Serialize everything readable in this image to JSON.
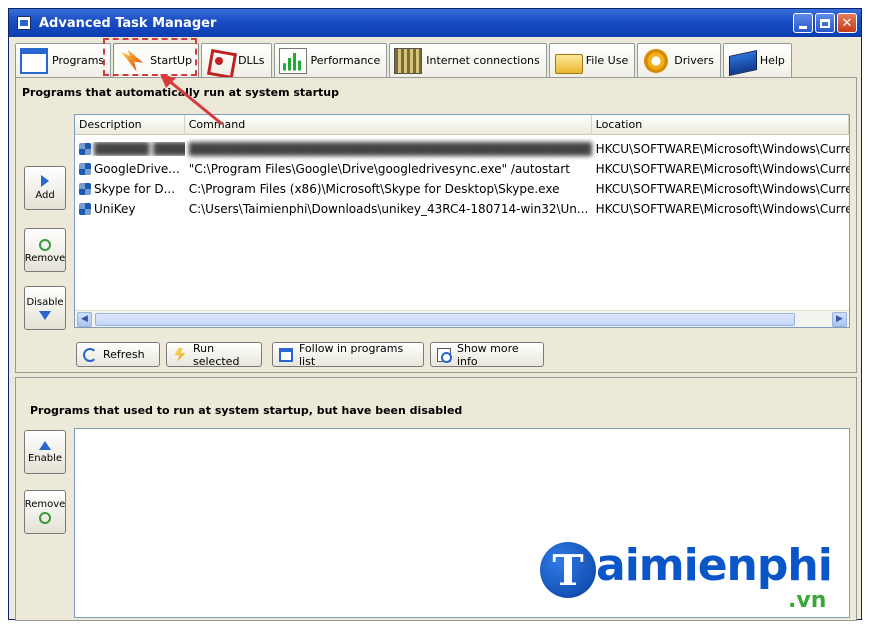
{
  "window": {
    "title": "Advanced Task Manager"
  },
  "tabs": [
    {
      "label": "Programs",
      "icon": "programs-icon"
    },
    {
      "label": "StartUp",
      "icon": "startup-icon",
      "active": true
    },
    {
      "label": "DLLs",
      "icon": "dlls-icon"
    },
    {
      "label": "Performance",
      "icon": "performance-icon"
    },
    {
      "label": "Internet connections",
      "icon": "internet-connections-icon"
    },
    {
      "label": "File Use",
      "icon": "file-use-icon"
    },
    {
      "label": "Drivers",
      "icon": "drivers-icon"
    },
    {
      "label": "Help",
      "icon": "help-icon"
    }
  ],
  "startup": {
    "title": "Programs that automatically run at system startup",
    "side_buttons": {
      "add": "Add",
      "remove": "Remove",
      "disable": "Disable"
    },
    "columns": [
      "Description",
      "Command",
      "Location"
    ],
    "rows": [
      {
        "description": "",
        "command": "",
        "location": "HKCU\\SOFTWARE\\Microsoft\\Windows\\Curre"
      },
      {
        "description": "GoogleDrive...",
        "command": "\"C:\\Program Files\\Google\\Drive\\googledrivesync.exe\" /autostart",
        "location": "HKCU\\SOFTWARE\\Microsoft\\Windows\\Curre"
      },
      {
        "description": "Skype for D...",
        "command": "C:\\Program Files (x86)\\Microsoft\\Skype for Desktop\\Skype.exe",
        "location": "HKCU\\SOFTWARE\\Microsoft\\Windows\\Curre"
      },
      {
        "description": "UniKey",
        "command": "C:\\Users\\Taimienphi\\Downloads\\unikey_43RC4-180714-win32\\Un...",
        "location": "HKCU\\SOFTWARE\\Microsoft\\Windows\\Curre"
      }
    ],
    "action_buttons": {
      "refresh": "Refresh",
      "run_selected": "Run selected",
      "follow": "Follow in programs list",
      "show_more": "Show more info"
    }
  },
  "disabled": {
    "title": "Programs that used to run at system startup, but have been disabled",
    "side_buttons": {
      "enable": "Enable",
      "remove": "Remove"
    }
  },
  "watermark": {
    "logo_letter": "T",
    "brand": "aimienphi",
    "tld": ".vn"
  },
  "colors": {
    "titlebar": "#0b3db0",
    "annotation": "#d63b3b",
    "watermark_blue": "#0a55c8",
    "watermark_green": "#3aa838"
  }
}
